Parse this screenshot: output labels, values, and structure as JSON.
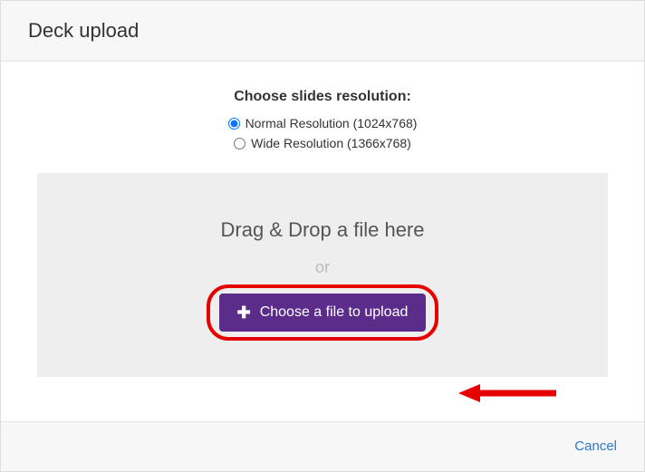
{
  "header": {
    "title": "Deck upload"
  },
  "resolution": {
    "heading": "Choose slides resolution:",
    "options": [
      {
        "label": "Normal Resolution (1024x768)",
        "selected": true
      },
      {
        "label": "Wide Resolution (1366x768)",
        "selected": false
      }
    ]
  },
  "dropzone": {
    "drag_text": "Drag & Drop a file here",
    "or_text": "or",
    "button_label": "Choose a file to upload"
  },
  "footer": {
    "cancel_label": "Cancel"
  }
}
